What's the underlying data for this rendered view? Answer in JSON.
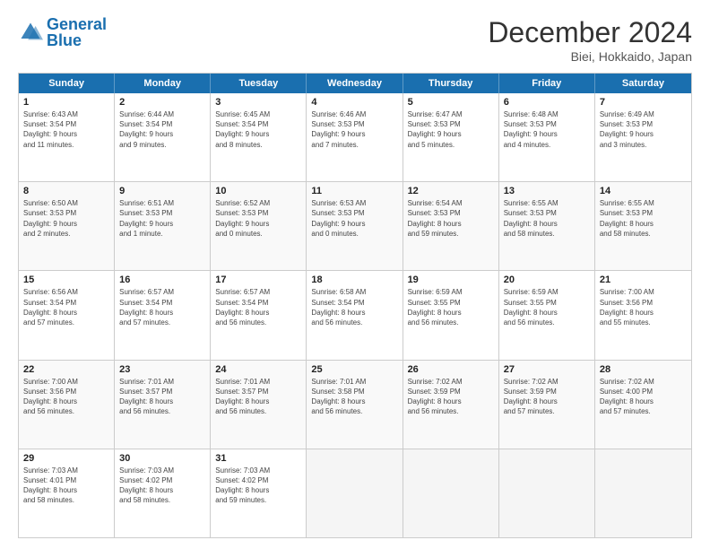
{
  "header": {
    "logo_general": "General",
    "logo_blue": "Blue",
    "month": "December 2024",
    "location": "Biei, Hokkaido, Japan"
  },
  "weekdays": [
    "Sunday",
    "Monday",
    "Tuesday",
    "Wednesday",
    "Thursday",
    "Friday",
    "Saturday"
  ],
  "rows": [
    [
      {
        "day": "1",
        "info": "Sunrise: 6:43 AM\nSunset: 3:54 PM\nDaylight: 9 hours\nand 11 minutes."
      },
      {
        "day": "2",
        "info": "Sunrise: 6:44 AM\nSunset: 3:54 PM\nDaylight: 9 hours\nand 9 minutes."
      },
      {
        "day": "3",
        "info": "Sunrise: 6:45 AM\nSunset: 3:54 PM\nDaylight: 9 hours\nand 8 minutes."
      },
      {
        "day": "4",
        "info": "Sunrise: 6:46 AM\nSunset: 3:53 PM\nDaylight: 9 hours\nand 7 minutes."
      },
      {
        "day": "5",
        "info": "Sunrise: 6:47 AM\nSunset: 3:53 PM\nDaylight: 9 hours\nand 5 minutes."
      },
      {
        "day": "6",
        "info": "Sunrise: 6:48 AM\nSunset: 3:53 PM\nDaylight: 9 hours\nand 4 minutes."
      },
      {
        "day": "7",
        "info": "Sunrise: 6:49 AM\nSunset: 3:53 PM\nDaylight: 9 hours\nand 3 minutes."
      }
    ],
    [
      {
        "day": "8",
        "info": "Sunrise: 6:50 AM\nSunset: 3:53 PM\nDaylight: 9 hours\nand 2 minutes."
      },
      {
        "day": "9",
        "info": "Sunrise: 6:51 AM\nSunset: 3:53 PM\nDaylight: 9 hours\nand 1 minute."
      },
      {
        "day": "10",
        "info": "Sunrise: 6:52 AM\nSunset: 3:53 PM\nDaylight: 9 hours\nand 0 minutes."
      },
      {
        "day": "11",
        "info": "Sunrise: 6:53 AM\nSunset: 3:53 PM\nDaylight: 9 hours\nand 0 minutes."
      },
      {
        "day": "12",
        "info": "Sunrise: 6:54 AM\nSunset: 3:53 PM\nDaylight: 8 hours\nand 59 minutes."
      },
      {
        "day": "13",
        "info": "Sunrise: 6:55 AM\nSunset: 3:53 PM\nDaylight: 8 hours\nand 58 minutes."
      },
      {
        "day": "14",
        "info": "Sunrise: 6:55 AM\nSunset: 3:53 PM\nDaylight: 8 hours\nand 58 minutes."
      }
    ],
    [
      {
        "day": "15",
        "info": "Sunrise: 6:56 AM\nSunset: 3:54 PM\nDaylight: 8 hours\nand 57 minutes."
      },
      {
        "day": "16",
        "info": "Sunrise: 6:57 AM\nSunset: 3:54 PM\nDaylight: 8 hours\nand 57 minutes."
      },
      {
        "day": "17",
        "info": "Sunrise: 6:57 AM\nSunset: 3:54 PM\nDaylight: 8 hours\nand 56 minutes."
      },
      {
        "day": "18",
        "info": "Sunrise: 6:58 AM\nSunset: 3:54 PM\nDaylight: 8 hours\nand 56 minutes."
      },
      {
        "day": "19",
        "info": "Sunrise: 6:59 AM\nSunset: 3:55 PM\nDaylight: 8 hours\nand 56 minutes."
      },
      {
        "day": "20",
        "info": "Sunrise: 6:59 AM\nSunset: 3:55 PM\nDaylight: 8 hours\nand 56 minutes."
      },
      {
        "day": "21",
        "info": "Sunrise: 7:00 AM\nSunset: 3:56 PM\nDaylight: 8 hours\nand 55 minutes."
      }
    ],
    [
      {
        "day": "22",
        "info": "Sunrise: 7:00 AM\nSunset: 3:56 PM\nDaylight: 8 hours\nand 56 minutes."
      },
      {
        "day": "23",
        "info": "Sunrise: 7:01 AM\nSunset: 3:57 PM\nDaylight: 8 hours\nand 56 minutes."
      },
      {
        "day": "24",
        "info": "Sunrise: 7:01 AM\nSunset: 3:57 PM\nDaylight: 8 hours\nand 56 minutes."
      },
      {
        "day": "25",
        "info": "Sunrise: 7:01 AM\nSunset: 3:58 PM\nDaylight: 8 hours\nand 56 minutes."
      },
      {
        "day": "26",
        "info": "Sunrise: 7:02 AM\nSunset: 3:59 PM\nDaylight: 8 hours\nand 56 minutes."
      },
      {
        "day": "27",
        "info": "Sunrise: 7:02 AM\nSunset: 3:59 PM\nDaylight: 8 hours\nand 57 minutes."
      },
      {
        "day": "28",
        "info": "Sunrise: 7:02 AM\nSunset: 4:00 PM\nDaylight: 8 hours\nand 57 minutes."
      }
    ],
    [
      {
        "day": "29",
        "info": "Sunrise: 7:03 AM\nSunset: 4:01 PM\nDaylight: 8 hours\nand 58 minutes."
      },
      {
        "day": "30",
        "info": "Sunrise: 7:03 AM\nSunset: 4:02 PM\nDaylight: 8 hours\nand 58 minutes."
      },
      {
        "day": "31",
        "info": "Sunrise: 7:03 AM\nSunset: 4:02 PM\nDaylight: 8 hours\nand 59 minutes."
      },
      {
        "day": "",
        "info": ""
      },
      {
        "day": "",
        "info": ""
      },
      {
        "day": "",
        "info": ""
      },
      {
        "day": "",
        "info": ""
      }
    ]
  ]
}
